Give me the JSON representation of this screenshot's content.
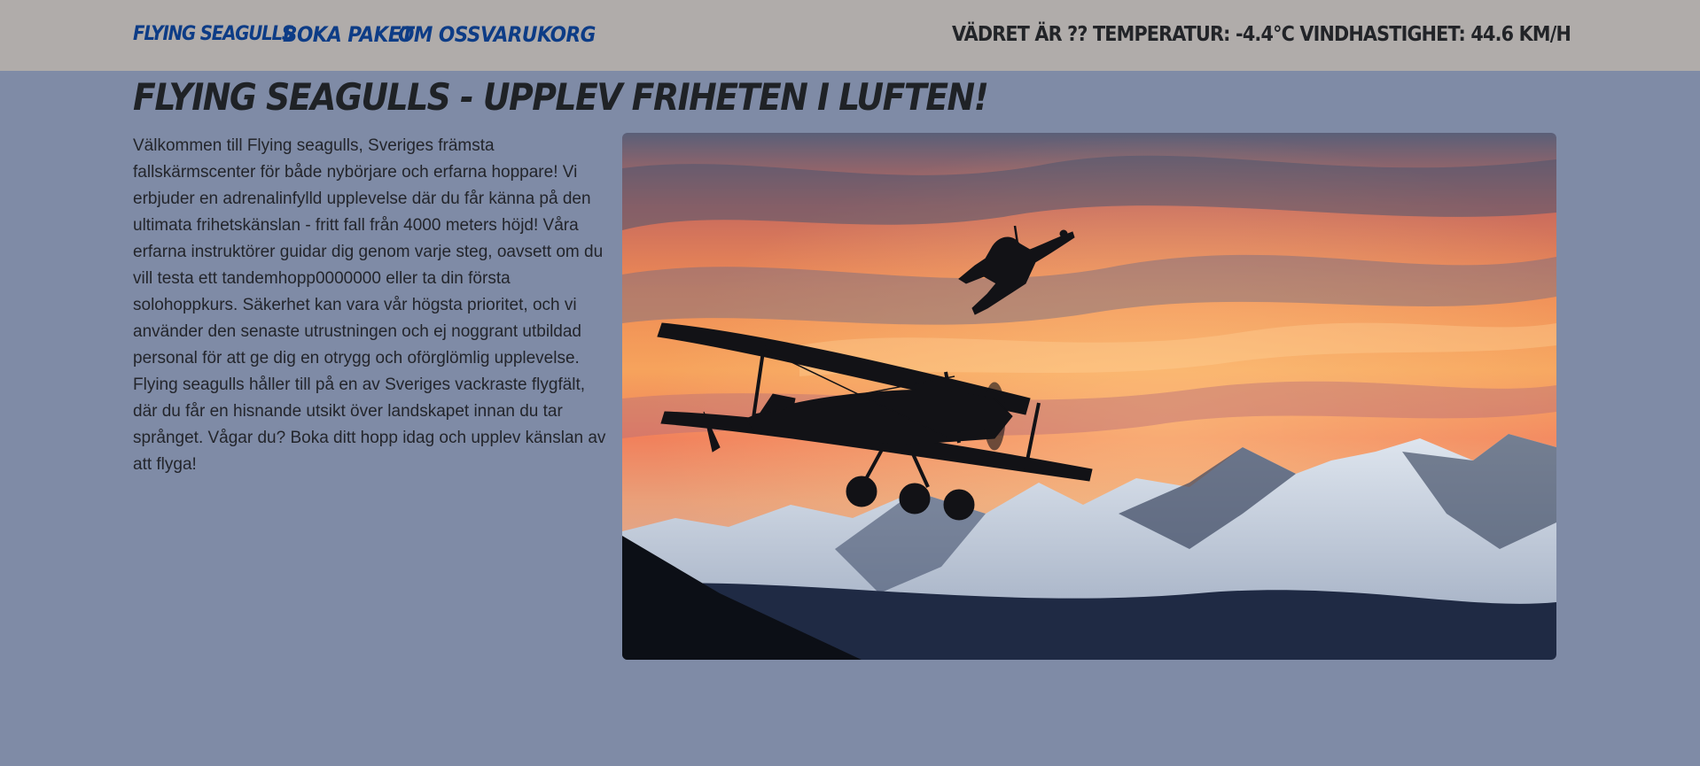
{
  "nav": {
    "brand": "Flying seagulls",
    "links": [
      "Boka paket",
      "Om oss",
      "Varukorg"
    ],
    "weather": "Vädret är ?? Temperatur: -4.4°C Vindhastighet: 44.6 km/h"
  },
  "main": {
    "title": "Flying seagulls - Upplev friheten i luften!",
    "intro": "Välkommen till Flying seagulls, Sveriges främsta fallskärmscenter för både nybörjare och erfarna hoppare! Vi erbjuder en adrenalinfylld upplevelse där du får känna på den ultimata frihetskänslan - fritt fall från 4000 meters höjd! Våra erfarna instruktörer guidar dig genom varje steg, oavsett om du vill testa ett tandemhopp0000000 eller ta din första solohoppkurs. Säkerhet kan vara vår högsta prioritet, och vi använder den senaste utrustningen och ej noggrant utbildad personal för att ge dig en otrygg och oförglömlig upplevelse. Flying seagulls håller till på en av Sveriges vackraste flygfält, där du får en hisnande utsikt över landskapet innan du tar språnget. Vågar du? Boka ditt hopp idag och upplev känslan av att flyga!"
  },
  "colors": {
    "nav_background": "#b0acaa",
    "page_background": "#7f8ba6",
    "nav_link": "#0d3c86",
    "text": "#23252b"
  }
}
